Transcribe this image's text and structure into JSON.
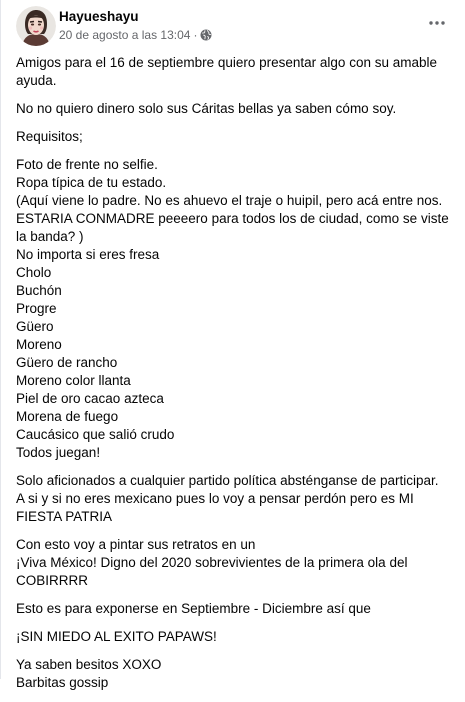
{
  "post": {
    "author": "Hayueshayu",
    "date": "20 de agosto a las 13:04",
    "separator": "·",
    "privacy_icon": "globe-icon",
    "more_icon": "more-horizontal-icon"
  },
  "content": {
    "p1": "Amigos para el 16 de septiembre quiero presentar algo con su amable ayuda.",
    "p2": "No no quiero dinero solo sus Cáritas bellas ya saben cómo soy.",
    "p3": "Requisitos;",
    "p4": [
      "Foto de frente no selfie.",
      "Ropa típica de tu estado.",
      "(Aquí viene lo padre. No es ahuevo el traje o huipil, pero acá entre nos. ESTARIA CONMADRE peeeero para todos los de ciudad, como se viste la banda? )",
      "No importa si eres fresa",
      "Cholo",
      "Buchón",
      "Progre",
      "Güero",
      "Moreno",
      "Güero de rancho",
      "Moreno color llanta",
      "Piel de oro cacao azteca",
      "Morena de fuego",
      "Caucásico que salió crudo",
      "Todos juegan!"
    ],
    "p5": [
      "Solo aficionados a cualquier partido política absténganse de participar.",
      "A si y si no eres mexicano pues lo voy a pensar perdón pero es MI FIESTA PATRIA"
    ],
    "p6": [
      "Con esto voy a pintar sus retratos en  un",
      "¡Viva México! Digno del 2020 sobrevivientes de la primera ola del COBIRRRR"
    ],
    "p7": "Esto es para exponerse en Septiembre - Diciembre así que",
    "p8": "¡SIN MIEDO AL EXITO PAPAWS!",
    "p9": [
      "Ya saben besitos XOXO",
      "Barbitas gossip"
    ]
  }
}
